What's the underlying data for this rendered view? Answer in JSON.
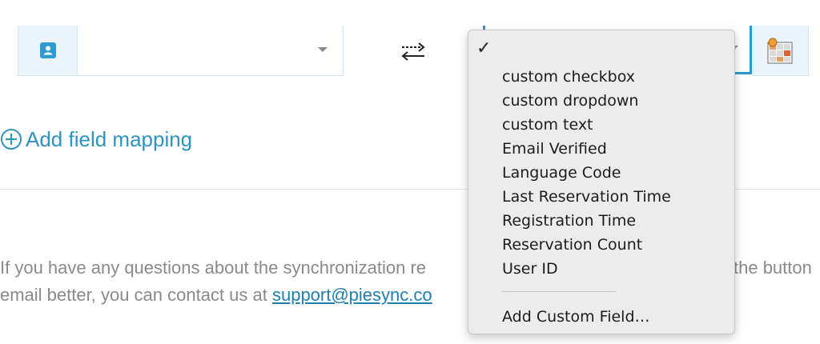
{
  "left_select": {
    "value": "",
    "icon": "contact-card-icon"
  },
  "swap_icon": "swap-arrows-icon",
  "right_select": {
    "value": ""
  },
  "app_icon": "grid-app-icon",
  "add_mapping": {
    "label": "Add field mapping",
    "icon": "plus-circle-icon"
  },
  "paragraph": {
    "line1_left": "If you have any questions about the synchronization re",
    "line1_right": "the button",
    "line2_left": "email better, you can contact us at ",
    "email": "support@piesync.co"
  },
  "menu": {
    "selected_mark": "✓",
    "items": [
      "custom checkbox",
      "custom dropdown",
      "custom text",
      "Email Verified",
      "Language Code",
      "Last Reservation Time",
      "Registration Time",
      "Reservation Count",
      "User ID"
    ],
    "footer": "Add Custom Field…"
  },
  "colors": {
    "accent": "#2d93c1",
    "link": "#1f7fb0",
    "menu_bg": "#ececec",
    "text_muted": "#8a8a8a"
  }
}
